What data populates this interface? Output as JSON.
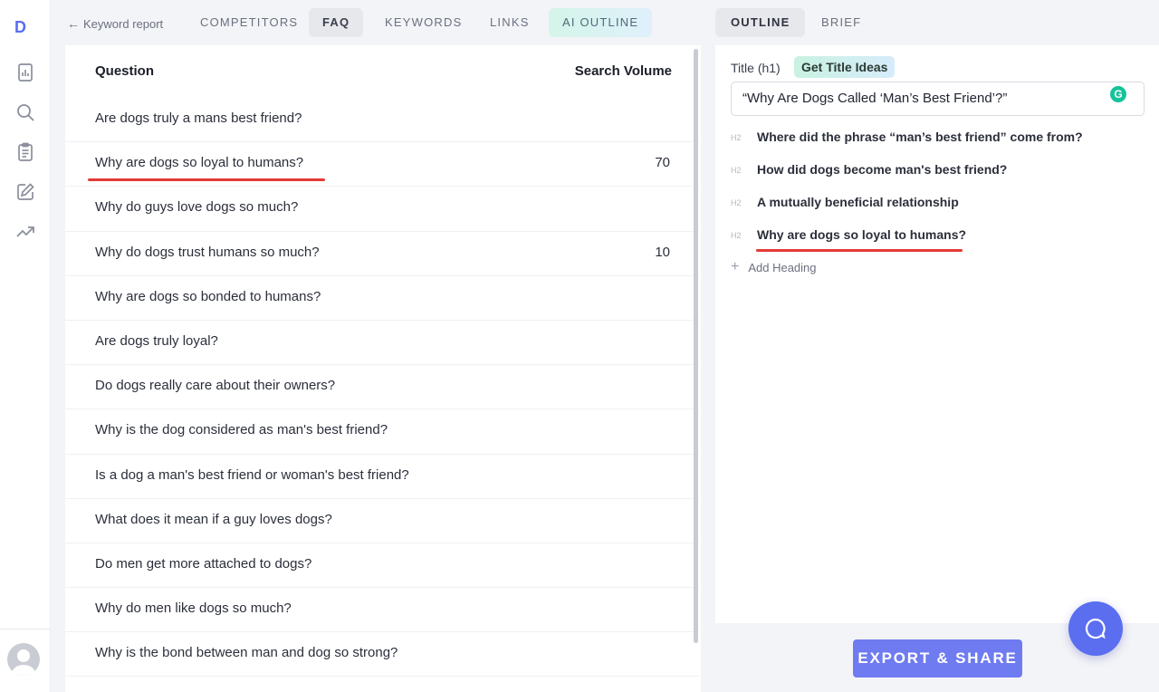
{
  "rail": {
    "logo": "D",
    "icons": [
      "report-icon",
      "search-icon",
      "clipboard-icon",
      "edit-icon",
      "trend-icon"
    ]
  },
  "nav": {
    "back_label": "Keyword report",
    "tabs": [
      "COMPETITORS",
      "FAQ",
      "KEYWORDS",
      "LINKS",
      "AI OUTLINE"
    ],
    "active_tab": "FAQ"
  },
  "faq": {
    "col_question": "Question",
    "col_volume": "Search Volume",
    "rows": [
      {
        "q": "Are dogs truly a mans best friend?",
        "v": ""
      },
      {
        "q": "Why are dogs so loyal to humans?",
        "v": "70"
      },
      {
        "q": "Why do guys love dogs so much?",
        "v": ""
      },
      {
        "q": "Why do dogs trust humans so much?",
        "v": "10"
      },
      {
        "q": "Why are dogs so bonded to humans?",
        "v": ""
      },
      {
        "q": "Are dogs truly loyal?",
        "v": ""
      },
      {
        "q": "Do dogs really care about their owners?",
        "v": ""
      },
      {
        "q": "Why is the dog considered as man's best friend?",
        "v": ""
      },
      {
        "q": "Is a dog a man's best friend or woman's best friend?",
        "v": ""
      },
      {
        "q": "What does it mean if a guy loves dogs?",
        "v": ""
      },
      {
        "q": "Do men get more attached to dogs?",
        "v": ""
      },
      {
        "q": "Why do men like dogs so much?",
        "v": ""
      },
      {
        "q": "Why is the bond between man and dog so strong?",
        "v": ""
      }
    ]
  },
  "right_tabs": [
    "OUTLINE",
    "BRIEF"
  ],
  "outline": {
    "title_label": "Title (h1)",
    "title_ideas_button": "Get Title Ideas",
    "title_value": "“Why Are Dogs Called ‘Man’s Best Friend’?”",
    "grammarly_badge": "G",
    "headings": [
      {
        "tag": "H2",
        "text": "Where did the phrase “man’s best friend” come from?"
      },
      {
        "tag": "H2",
        "text": "How did dogs become man's best friend?"
      },
      {
        "tag": "H2",
        "text": "A mutually beneficial relationship"
      },
      {
        "tag": "H2",
        "text": "Why are dogs so loyal to humans?"
      }
    ],
    "add_heading_label": "Add Heading"
  },
  "export_label": "EXPORT & SHARE",
  "colors": {
    "accent": "#6f7bf0",
    "highlight_underline": "#e53935",
    "grammarly": "#15c39a"
  }
}
